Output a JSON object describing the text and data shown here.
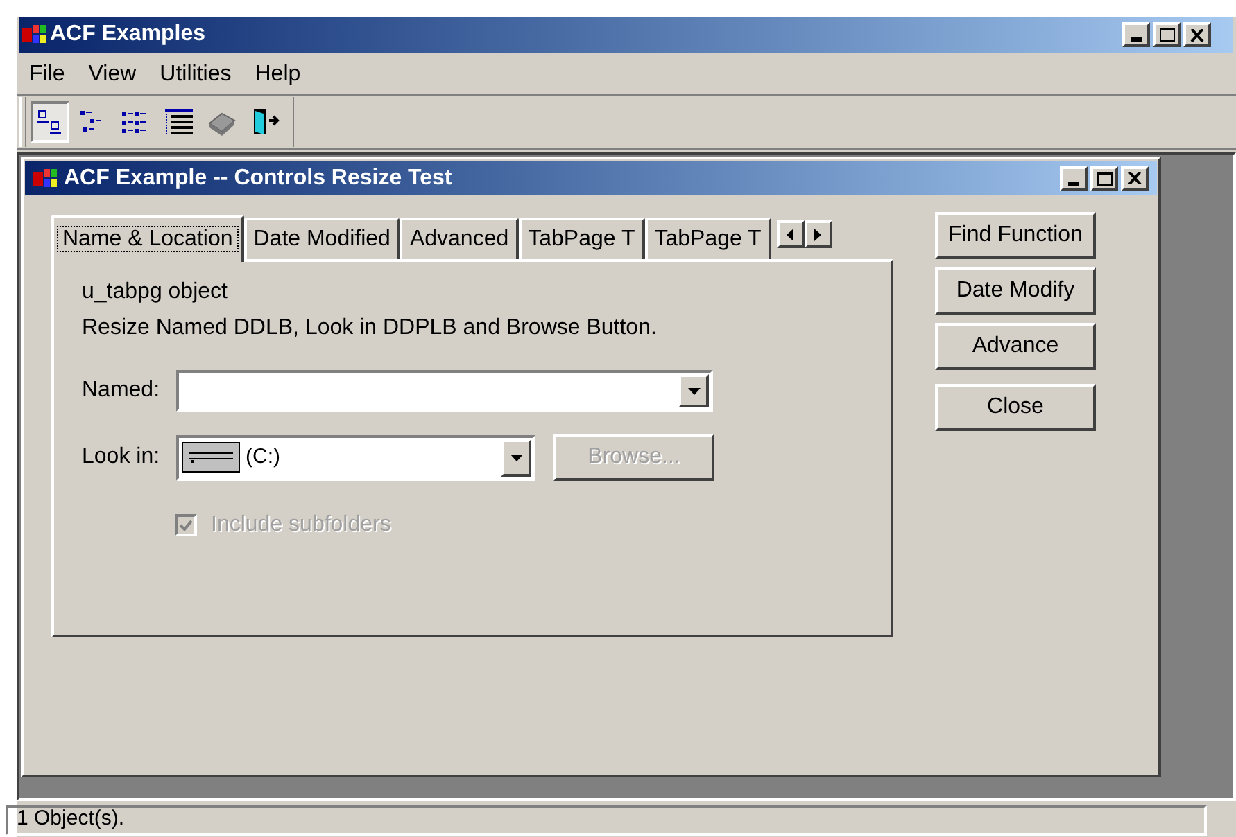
{
  "window": {
    "title": "ACF Examples"
  },
  "menu": [
    {
      "label": "File"
    },
    {
      "label": "View"
    },
    {
      "label": "Utilities"
    },
    {
      "label": "Help"
    }
  ],
  "toolbar": [
    {
      "kind": "details",
      "pressed": true
    },
    {
      "kind": "tree",
      "pressed": false
    },
    {
      "kind": "list",
      "pressed": false
    },
    {
      "kind": "grid",
      "pressed": false
    },
    {
      "kind": "disk",
      "pressed": false
    },
    {
      "kind": "exit",
      "pressed": false
    }
  ],
  "child_window": {
    "title": "ACF Example -- Controls Resize Test",
    "tabs": [
      {
        "label": "Name & Location",
        "selected": true
      },
      {
        "label": "Date Modified",
        "selected": false
      },
      {
        "label": "Advanced",
        "selected": false
      },
      {
        "label": "TabPage T",
        "selected": false
      },
      {
        "label": "TabPage T",
        "selected": false
      }
    ],
    "tab_page": {
      "title": "u_tabpg object",
      "description": "Resize Named DDLB, Look in DDPLB and Browse Button.",
      "named": {
        "label": "Named:"
      },
      "look_in": {
        "label": "Look in:",
        "value": "(C:)"
      },
      "browse": {
        "label": "Browse...",
        "disabled": true
      },
      "include_subfolders": {
        "label": "Include subfolders",
        "checked": true,
        "disabled": true
      }
    },
    "buttons": [
      {
        "label": "Find Function"
      },
      {
        "label": "Date Modify"
      },
      {
        "label": "Advance"
      },
      {
        "label": "Close"
      }
    ]
  },
  "status_bar": {
    "text": "1 Object(s)."
  }
}
